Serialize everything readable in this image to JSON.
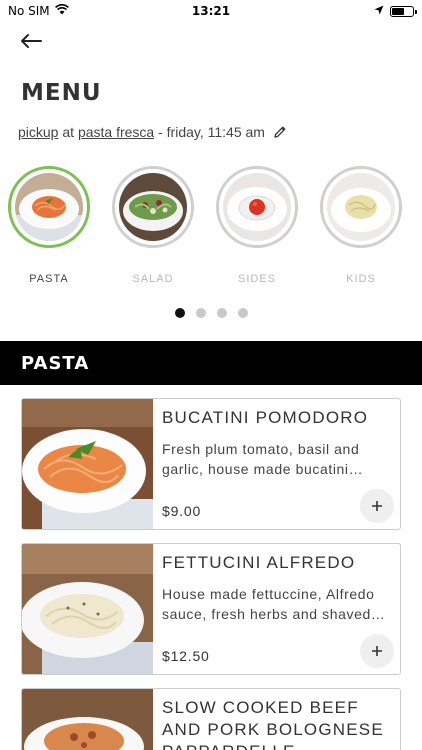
{
  "status_bar": {
    "carrier": "No SIM",
    "time": "13:21"
  },
  "header": {
    "title": "MENU"
  },
  "order": {
    "mode": "pickup",
    "connector": "at",
    "location": "pasta fresca",
    "separator": "-",
    "when": "friday, 11:45 am"
  },
  "categories": [
    {
      "label": "PASTA",
      "active": true
    },
    {
      "label": "SALAD",
      "active": false
    },
    {
      "label": "SIDES",
      "active": false
    },
    {
      "label": "KIDS",
      "active": false
    }
  ],
  "pagination": {
    "pages": 4,
    "current": 1
  },
  "section": {
    "title": "PASTA"
  },
  "items": [
    {
      "name": "BUCATINI POMODORO",
      "description": "Fresh plum tomato, basil and garlic, house made bucatini pasta",
      "price": "$9.00"
    },
    {
      "name": "FETTUCINI ALFREDO",
      "description": "House made fettuccine, Alfredo sauce, fresh herbs and shaved parmesan",
      "price": "$12.50"
    },
    {
      "name": "SLOW COOKED BEEF AND PORK BOLOGNESE PAPPARDELLE",
      "description": "",
      "price": ""
    }
  ],
  "icons": {
    "back": "arrow-left-icon",
    "edit": "pencil-icon",
    "add": "plus-icon"
  },
  "colors": {
    "active_ring": "#7cc152",
    "header_bg": "#000000",
    "inactive_ring": "#cfcfcf"
  }
}
